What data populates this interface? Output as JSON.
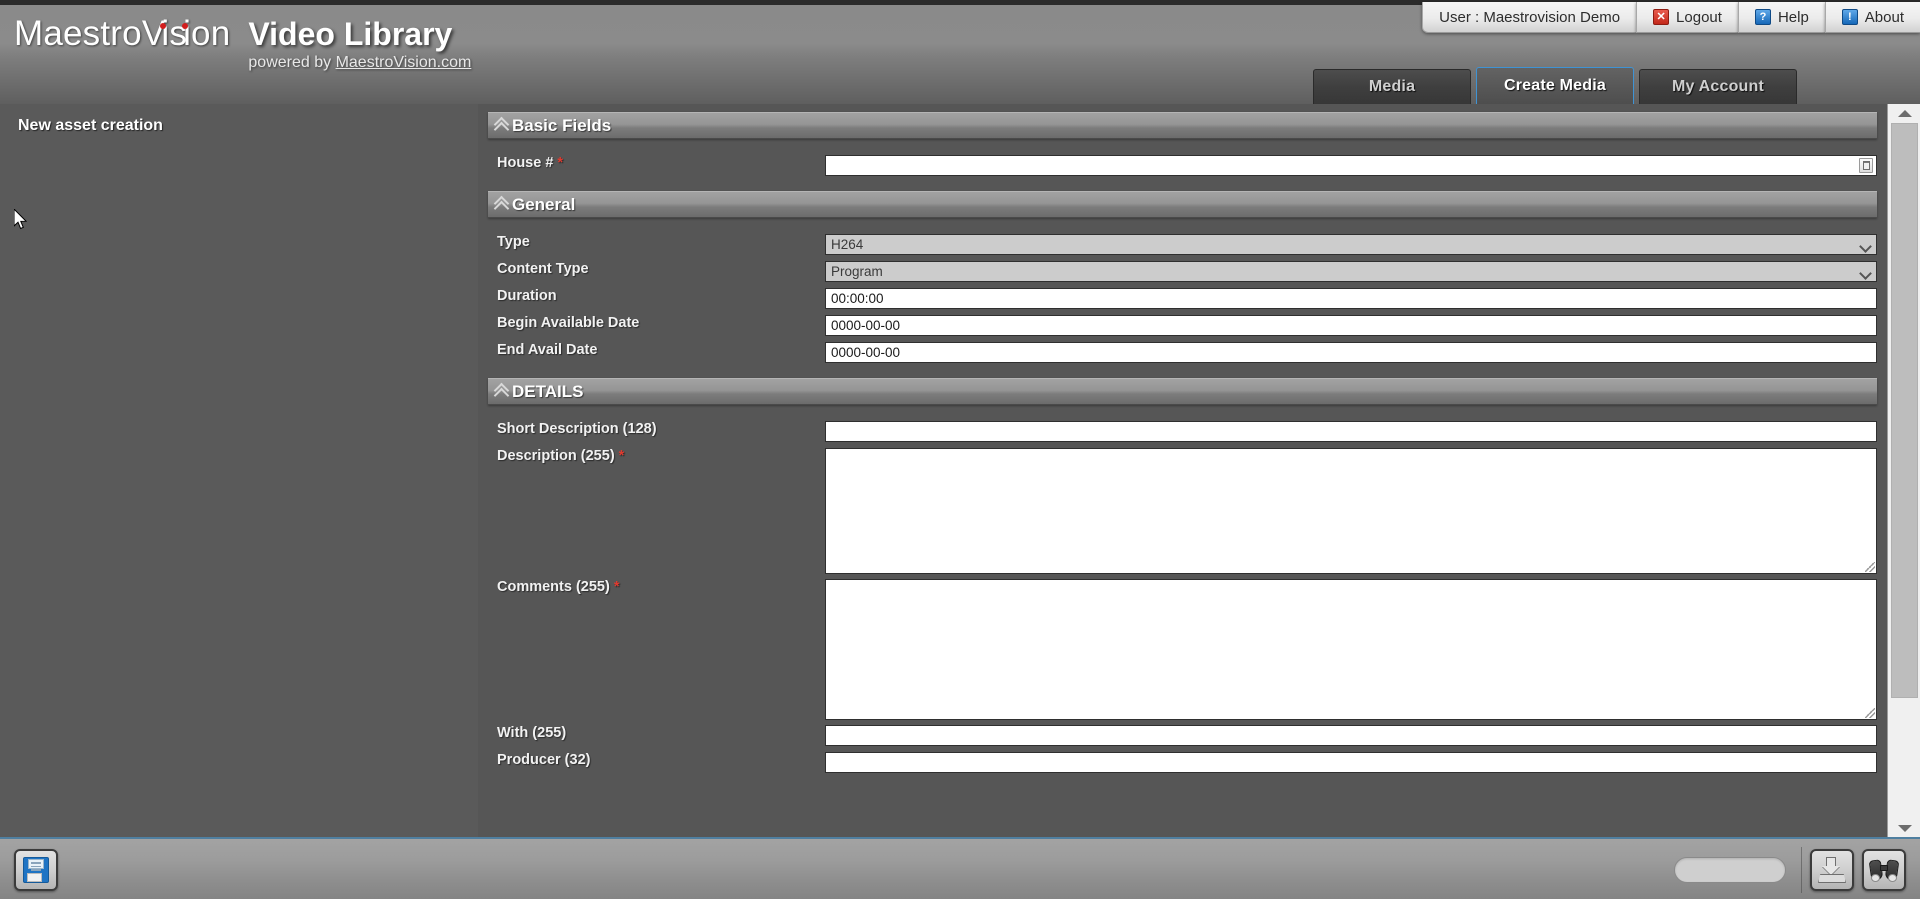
{
  "header": {
    "logo_text": "MaestroVision",
    "app_title": "Video Library",
    "powered_prefix": "powered by ",
    "powered_link": "MaestroVision.com"
  },
  "userbar": {
    "user_label": "User : Maestrovision Demo",
    "logout_label": "Logout",
    "logout_icon": "close-x-icon",
    "help_label": "Help",
    "help_icon": "question-mark-icon",
    "about_label": "About",
    "about_icon": "info-exclamation-icon",
    "logout_icon_glyph": "✕",
    "help_icon_glyph": "?",
    "about_icon_glyph": "!"
  },
  "tabs": [
    {
      "label": "Media",
      "active": false
    },
    {
      "label": "Create Media",
      "active": true
    },
    {
      "label": "My Account",
      "active": false
    }
  ],
  "sidebar": {
    "title": "New asset creation"
  },
  "sections": {
    "basic": {
      "title": "Basic Fields",
      "fields": {
        "house_label": "House #",
        "house_value": "",
        "house_required": "*",
        "house_picker_icon": "list-picker-icon"
      }
    },
    "general": {
      "title": "General",
      "type_label": "Type",
      "type_value": "H264",
      "content_type_label": "Content Type",
      "content_type_value": "Program",
      "duration_label": "Duration",
      "duration_value": "00:00:00",
      "begin_date_label": "Begin Available Date",
      "begin_date_value": "0000-00-00",
      "end_date_label": "End Avail Date",
      "end_date_value": "0000-00-00"
    },
    "details": {
      "title": "DETAILS",
      "short_desc_label": "Short Description (128)",
      "short_desc_value": "",
      "description_label": "Description (255)",
      "description_required": "*",
      "description_value": "",
      "comments_label": "Comments (255)",
      "comments_required": "*",
      "comments_value": "",
      "with_label": "With (255)",
      "with_value": "",
      "producer_label": "Producer (32)",
      "producer_value": ""
    }
  },
  "bottombar": {
    "save_icon": "floppy-disk-save-icon",
    "import_icon": "download-into-tray-icon",
    "browse_icon": "binoculars-search-icon",
    "status_value": ""
  },
  "scrollbar": {
    "up_icon": "triangle-up-icon",
    "down_icon": "triangle-down-icon"
  },
  "colors": {
    "accent_blue": "#3f93d4",
    "required_red": "#e03a2f",
    "logo_dot_red": "#d21d1d",
    "page_bg": "#5a5a5a",
    "content_bg": "#565656"
  }
}
